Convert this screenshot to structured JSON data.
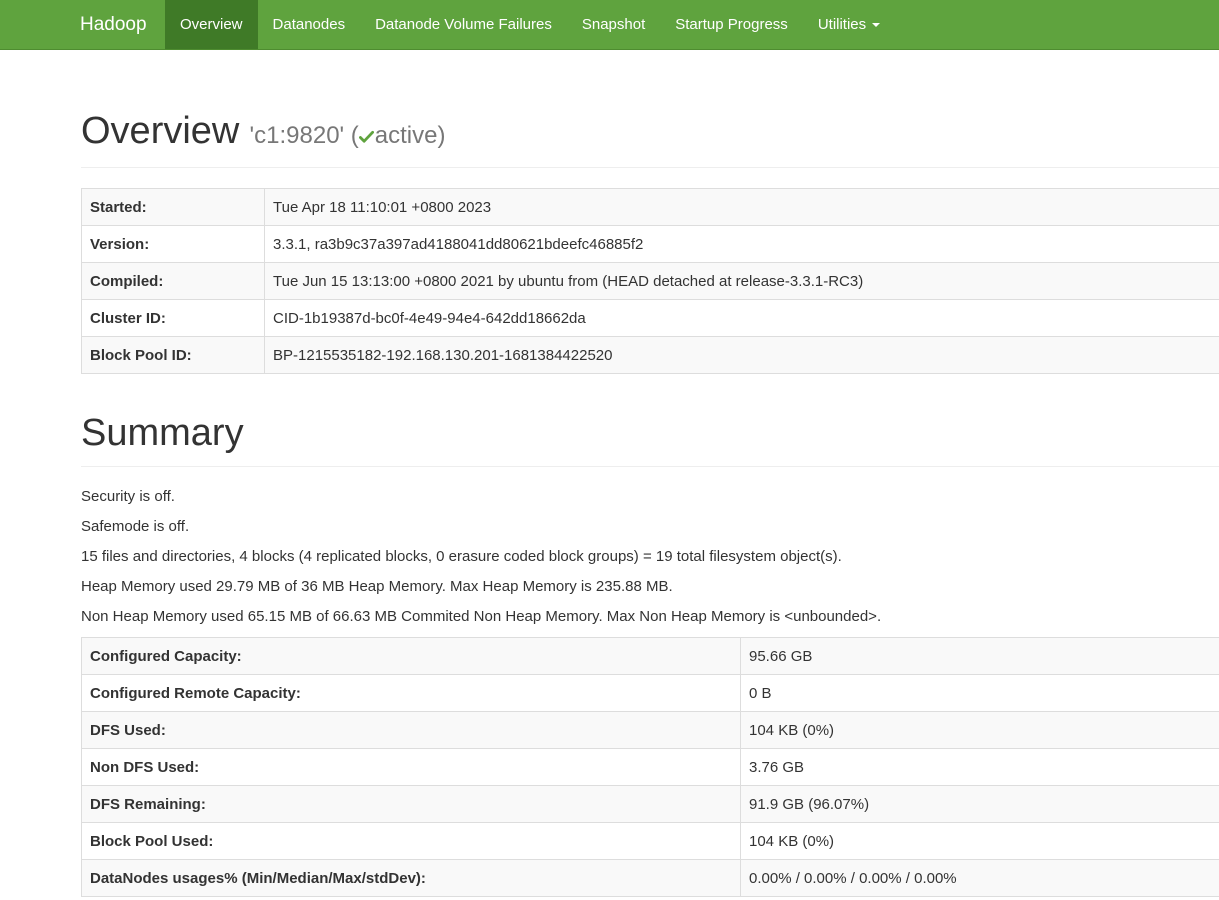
{
  "navbar": {
    "brand": "Hadoop",
    "items": [
      {
        "label": "Overview",
        "active": true
      },
      {
        "label": "Datanodes",
        "active": false
      },
      {
        "label": "Datanode Volume Failures",
        "active": false
      },
      {
        "label": "Snapshot",
        "active": false
      },
      {
        "label": "Startup Progress",
        "active": false
      },
      {
        "label": "Utilities",
        "active": false,
        "dropdown": true
      }
    ]
  },
  "overview": {
    "title": "Overview",
    "host": "'c1:9820' (",
    "state": "active",
    "state_close": ")",
    "state_icon": "check-icon",
    "rows": [
      {
        "key": "Started:",
        "value": "Tue Apr 18 11:10:01 +0800 2023"
      },
      {
        "key": "Version:",
        "value": "3.3.1, ra3b9c37a397ad4188041dd80621bdeefc46885f2"
      },
      {
        "key": "Compiled:",
        "value": "Tue Jun 15 13:13:00 +0800 2021 by ubuntu from (HEAD detached at release-3.3.1-RC3)"
      },
      {
        "key": "Cluster ID:",
        "value": "CID-1b19387d-bc0f-4e49-94e4-642dd18662da"
      },
      {
        "key": "Block Pool ID:",
        "value": "BP-1215535182-192.168.130.201-1681384422520"
      }
    ]
  },
  "summary": {
    "title": "Summary",
    "lines": [
      "Security is off.",
      "Safemode is off.",
      "15 files and directories, 4 blocks (4 replicated blocks, 0 erasure coded block groups) = 19 total filesystem object(s).",
      "Heap Memory used 29.79 MB of 36 MB Heap Memory. Max Heap Memory is 235.88 MB.",
      "Non Heap Memory used 65.15 MB of 66.63 MB Commited Non Heap Memory. Max Non Heap Memory is <unbounded>."
    ],
    "rows": [
      {
        "key": "Configured Capacity:",
        "value": "95.66 GB"
      },
      {
        "key": "Configured Remote Capacity:",
        "value": "0 B"
      },
      {
        "key": "DFS Used:",
        "value": "104 KB (0%)"
      },
      {
        "key": "Non DFS Used:",
        "value": "3.76 GB"
      },
      {
        "key": "DFS Remaining:",
        "value": "91.9 GB (96.07%)"
      },
      {
        "key": "Block Pool Used:",
        "value": "104 KB (0%)"
      },
      {
        "key": "DataNodes usages% (Min/Median/Max/stdDev):",
        "value": "0.00% / 0.00% / 0.00% / 0.00%"
      }
    ]
  },
  "colors": {
    "navbar_bg": "#5fa33e",
    "navbar_active": "#3f7a27",
    "check": "#5fa33e"
  }
}
